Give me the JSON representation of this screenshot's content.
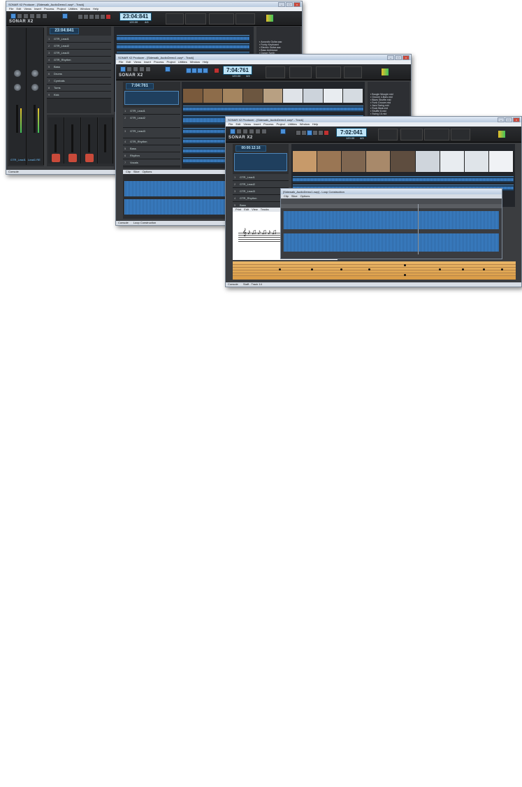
{
  "windows": [
    {
      "title": "SONAR X2 Producer - [Sidewalk_AudioDemo1.cwp* - Track]",
      "menu": [
        "File",
        "Edit",
        "Views",
        "Insert",
        "Process",
        "Project",
        "Utilities",
        "Window",
        "Help"
      ],
      "logo": "SONAR X2",
      "clock": "23:04:841",
      "secondary_clock": "23:04:841",
      "tempo": "120.00",
      "meter": "4/4",
      "tracks": [
        "GTR_Lead1",
        "GTR_Lead2",
        "GTR_Lead3",
        "GTR_Rhythm",
        "Bass",
        "Drums",
        "Cymbals",
        "Toms",
        "Kick"
      ],
      "browser_items": [
        "Acoustic Guitar.aac",
        "Funky Keyboard",
        "Electric Guitar.aac",
        "Bass Ambiance",
        "Dance Synth",
        "Drums"
      ],
      "strip_labels": [
        "GTR_Lead1",
        "Lead1 RE"
      ],
      "bottom_tab": "Console"
    },
    {
      "title": "SONAR X2 Producer - [Sidewalk_AudioDemo1.cwp* - Track]",
      "menu": [
        "File",
        "Edit",
        "Views",
        "Insert",
        "Process",
        "Project",
        "Utilities",
        "Window",
        "Help"
      ],
      "logo": "SONAR X2",
      "clock": "7:04:761",
      "secondary_clock": "7:04:761",
      "tempo": "120.00",
      "meter": "4/4",
      "tracks": [
        "GTR_Lead1",
        "GTR_Lead2",
        "GTR_Lead3",
        "GTR_Rhythm",
        "Bass",
        "Rhythm",
        "Vocals"
      ],
      "browser_items": [
        "Boogie Woogie.mid",
        "Groove 4-Bars.mid",
        "Blues Shuffle.mid",
        "Funk Groove.mid",
        "Jazz Swing.mid",
        "Rock Beat.mid",
        "Shuffle 8.mid",
        "Swing 16.mid"
      ],
      "clip_view_menu": [
        "Clip",
        "Slice",
        "Options"
      ],
      "bottom_tabs": [
        "Console",
        "Loop Construction"
      ]
    },
    {
      "title": "SONAR X2 Producer - [Sidewalk_AudioDemo1.cwp* - Track]",
      "menu": [
        "File",
        "Edit",
        "Views",
        "Insert",
        "Process",
        "Project",
        "Utilities",
        "Window",
        "Help"
      ],
      "logo": "SONAR X2",
      "clock": "7:02:041",
      "secondary_clock": "00:00:12:16",
      "tempo": "120.00",
      "meter": "4/4",
      "tracks": [
        "GTR_Lead1",
        "GTR_Lead2",
        "GTR_Lead3",
        "GTR_Rhythm",
        "Bass",
        "Drums"
      ],
      "loop_window_title": "[Sidewalk_AudioDemo1.cwp] - Loop Construction",
      "loop_menu": [
        "Clip",
        "Slice",
        "Options"
      ],
      "staff_menu": [
        "Print",
        "Edit",
        "View",
        "Tracks"
      ],
      "bottom_tabs": [
        "Console",
        "Staff - Track 14"
      ]
    }
  ]
}
